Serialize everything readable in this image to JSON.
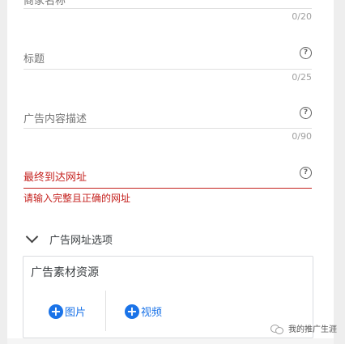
{
  "fields": [
    {
      "label": "商家名称",
      "counter": "0/20"
    },
    {
      "label": "标题",
      "counter": "0/25"
    },
    {
      "label": "广告内容描述",
      "counter": "0/90"
    },
    {
      "label": "最终到达网址",
      "error": "请输入完整且正确的网址"
    }
  ],
  "help_glyph": "?",
  "url_options": {
    "label": "广告网址选项"
  },
  "assets": {
    "title": "广告素材资源",
    "image_label": "图片",
    "video_label": "视频",
    "plus_glyph": "+"
  },
  "watermark": {
    "text": "我的推广生涯"
  },
  "colors": {
    "error": "#c5221f",
    "accent": "#1a73e8"
  }
}
